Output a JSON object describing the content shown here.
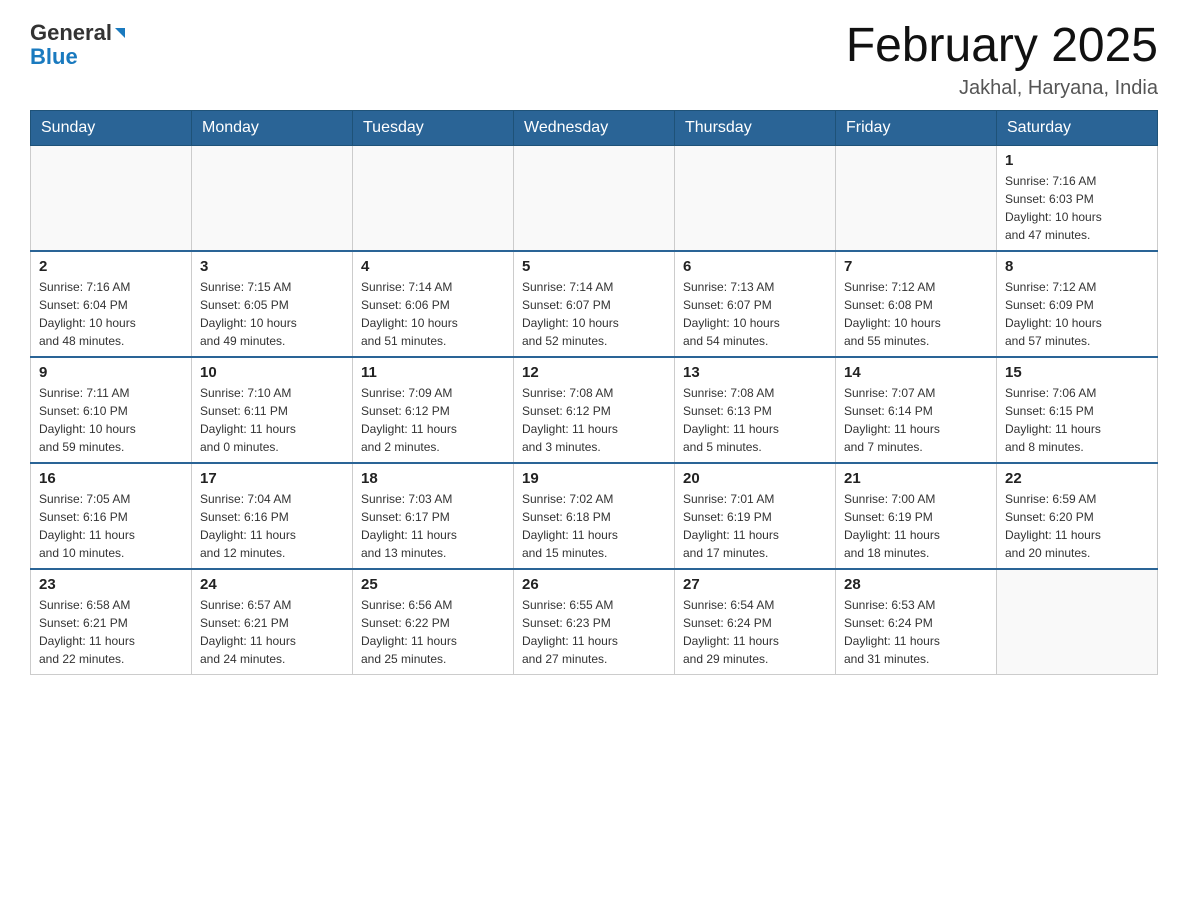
{
  "header": {
    "logo_general": "General",
    "logo_blue": "Blue",
    "month_title": "February 2025",
    "location": "Jakhal, Haryana, India"
  },
  "weekdays": [
    "Sunday",
    "Monday",
    "Tuesday",
    "Wednesday",
    "Thursday",
    "Friday",
    "Saturday"
  ],
  "weeks": [
    [
      {
        "day": "",
        "info": ""
      },
      {
        "day": "",
        "info": ""
      },
      {
        "day": "",
        "info": ""
      },
      {
        "day": "",
        "info": ""
      },
      {
        "day": "",
        "info": ""
      },
      {
        "day": "",
        "info": ""
      },
      {
        "day": "1",
        "info": "Sunrise: 7:16 AM\nSunset: 6:03 PM\nDaylight: 10 hours\nand 47 minutes."
      }
    ],
    [
      {
        "day": "2",
        "info": "Sunrise: 7:16 AM\nSunset: 6:04 PM\nDaylight: 10 hours\nand 48 minutes."
      },
      {
        "day": "3",
        "info": "Sunrise: 7:15 AM\nSunset: 6:05 PM\nDaylight: 10 hours\nand 49 minutes."
      },
      {
        "day": "4",
        "info": "Sunrise: 7:14 AM\nSunset: 6:06 PM\nDaylight: 10 hours\nand 51 minutes."
      },
      {
        "day": "5",
        "info": "Sunrise: 7:14 AM\nSunset: 6:07 PM\nDaylight: 10 hours\nand 52 minutes."
      },
      {
        "day": "6",
        "info": "Sunrise: 7:13 AM\nSunset: 6:07 PM\nDaylight: 10 hours\nand 54 minutes."
      },
      {
        "day": "7",
        "info": "Sunrise: 7:12 AM\nSunset: 6:08 PM\nDaylight: 10 hours\nand 55 minutes."
      },
      {
        "day": "8",
        "info": "Sunrise: 7:12 AM\nSunset: 6:09 PM\nDaylight: 10 hours\nand 57 minutes."
      }
    ],
    [
      {
        "day": "9",
        "info": "Sunrise: 7:11 AM\nSunset: 6:10 PM\nDaylight: 10 hours\nand 59 minutes."
      },
      {
        "day": "10",
        "info": "Sunrise: 7:10 AM\nSunset: 6:11 PM\nDaylight: 11 hours\nand 0 minutes."
      },
      {
        "day": "11",
        "info": "Sunrise: 7:09 AM\nSunset: 6:12 PM\nDaylight: 11 hours\nand 2 minutes."
      },
      {
        "day": "12",
        "info": "Sunrise: 7:08 AM\nSunset: 6:12 PM\nDaylight: 11 hours\nand 3 minutes."
      },
      {
        "day": "13",
        "info": "Sunrise: 7:08 AM\nSunset: 6:13 PM\nDaylight: 11 hours\nand 5 minutes."
      },
      {
        "day": "14",
        "info": "Sunrise: 7:07 AM\nSunset: 6:14 PM\nDaylight: 11 hours\nand 7 minutes."
      },
      {
        "day": "15",
        "info": "Sunrise: 7:06 AM\nSunset: 6:15 PM\nDaylight: 11 hours\nand 8 minutes."
      }
    ],
    [
      {
        "day": "16",
        "info": "Sunrise: 7:05 AM\nSunset: 6:16 PM\nDaylight: 11 hours\nand 10 minutes."
      },
      {
        "day": "17",
        "info": "Sunrise: 7:04 AM\nSunset: 6:16 PM\nDaylight: 11 hours\nand 12 minutes."
      },
      {
        "day": "18",
        "info": "Sunrise: 7:03 AM\nSunset: 6:17 PM\nDaylight: 11 hours\nand 13 minutes."
      },
      {
        "day": "19",
        "info": "Sunrise: 7:02 AM\nSunset: 6:18 PM\nDaylight: 11 hours\nand 15 minutes."
      },
      {
        "day": "20",
        "info": "Sunrise: 7:01 AM\nSunset: 6:19 PM\nDaylight: 11 hours\nand 17 minutes."
      },
      {
        "day": "21",
        "info": "Sunrise: 7:00 AM\nSunset: 6:19 PM\nDaylight: 11 hours\nand 18 minutes."
      },
      {
        "day": "22",
        "info": "Sunrise: 6:59 AM\nSunset: 6:20 PM\nDaylight: 11 hours\nand 20 minutes."
      }
    ],
    [
      {
        "day": "23",
        "info": "Sunrise: 6:58 AM\nSunset: 6:21 PM\nDaylight: 11 hours\nand 22 minutes."
      },
      {
        "day": "24",
        "info": "Sunrise: 6:57 AM\nSunset: 6:21 PM\nDaylight: 11 hours\nand 24 minutes."
      },
      {
        "day": "25",
        "info": "Sunrise: 6:56 AM\nSunset: 6:22 PM\nDaylight: 11 hours\nand 25 minutes."
      },
      {
        "day": "26",
        "info": "Sunrise: 6:55 AM\nSunset: 6:23 PM\nDaylight: 11 hours\nand 27 minutes."
      },
      {
        "day": "27",
        "info": "Sunrise: 6:54 AM\nSunset: 6:24 PM\nDaylight: 11 hours\nand 29 minutes."
      },
      {
        "day": "28",
        "info": "Sunrise: 6:53 AM\nSunset: 6:24 PM\nDaylight: 11 hours\nand 31 minutes."
      },
      {
        "day": "",
        "info": ""
      }
    ]
  ]
}
